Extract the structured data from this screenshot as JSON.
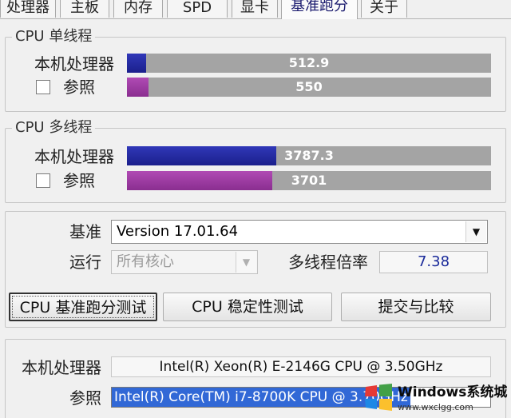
{
  "tabs": [
    {
      "label": "处理器"
    },
    {
      "label": "主板"
    },
    {
      "label": "内存"
    },
    {
      "label": "SPD"
    },
    {
      "label": "显卡"
    },
    {
      "label": "基准跑分",
      "active": true
    },
    {
      "label": "关于"
    }
  ],
  "single_thread": {
    "title": "CPU 单线程",
    "this_cpu": {
      "label": "本机处理器",
      "value": "512.9",
      "fraction": 0.052,
      "color": "#1b1f8c"
    },
    "reference": {
      "label": "参照",
      "checked": false,
      "value": "550",
      "fraction": 0.06,
      "color": "#8a2e90"
    }
  },
  "multi_thread": {
    "title": "CPU 多线程",
    "this_cpu": {
      "label": "本机处理器",
      "value": "3787.3",
      "fraction": 0.41,
      "color": "#1b1f8c"
    },
    "reference": {
      "label": "参照",
      "checked": false,
      "value": "3701",
      "fraction": 0.4,
      "color": "#8a2e90"
    }
  },
  "settings": {
    "baseline_label": "基准",
    "baseline_value": "Version 17.01.64",
    "run_label": "运行",
    "run_value": "所有核心",
    "ratio_label": "多线程倍率",
    "ratio_value": "7.38"
  },
  "buttons": {
    "bench": "CPU 基准跑分测试",
    "stress": "CPU 稳定性测试",
    "submit": "提交与比较"
  },
  "processors": {
    "this_cpu_label": "本机处理器",
    "this_cpu_value": "Intel(R) Xeon(R) E-2146G CPU @ 3.50GHz",
    "reference_label": "参照",
    "reference_value": "Intel(R) Core(TM) i7-8700K CPU @ 3.70GHz"
  },
  "watermark": {
    "title": "Windows系统城",
    "url": "www.wxclgg.com"
  }
}
